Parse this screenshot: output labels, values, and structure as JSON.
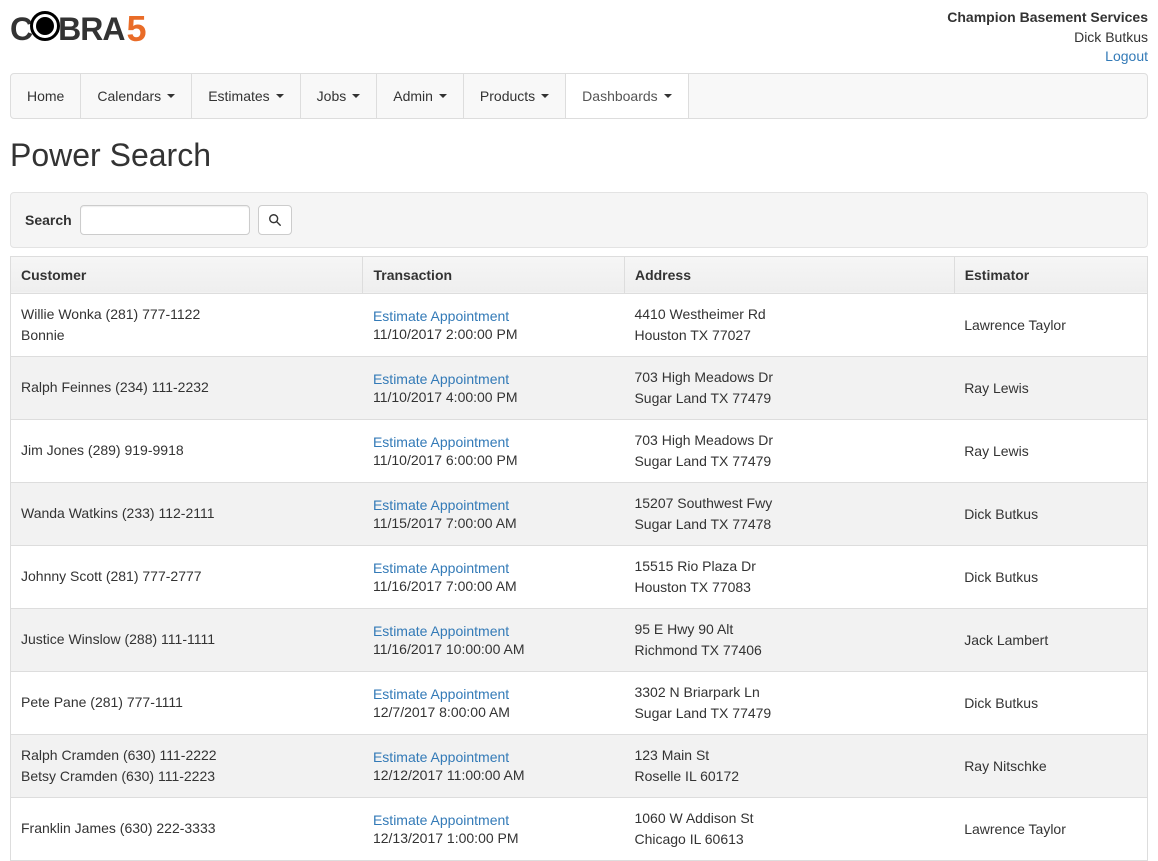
{
  "header": {
    "logo_text_1": "C",
    "logo_text_2": "BRA",
    "logo_text_3": "5",
    "company": "Champion Basement Services",
    "user": "Dick Butkus",
    "logout": "Logout"
  },
  "nav": {
    "home": "Home",
    "calendars": "Calendars",
    "estimates": "Estimates",
    "jobs": "Jobs",
    "admin": "Admin",
    "products": "Products",
    "dashboards": "Dashboards"
  },
  "page": {
    "title": "Power Search",
    "search_label": "Search",
    "search_value": ""
  },
  "table": {
    "headers": {
      "customer": "Customer",
      "transaction": "Transaction",
      "address": "Address",
      "estimator": "Estimator"
    },
    "rows": [
      {
        "cust1": "Willie Wonka (281) 777-1122",
        "cust2": "Bonnie",
        "trans_label": "Estimate Appointment",
        "trans_time": "11/10/2017 2:00:00 PM",
        "addr1": "4410 Westheimer Rd",
        "addr2": "Houston TX 77027",
        "estimator": "Lawrence Taylor"
      },
      {
        "cust1": "Ralph Feinnes (234) 111-2232",
        "cust2": "",
        "trans_label": "Estimate Appointment",
        "trans_time": "11/10/2017 4:00:00 PM",
        "addr1": "703 High Meadows Dr",
        "addr2": "Sugar Land TX 77479",
        "estimator": "Ray Lewis"
      },
      {
        "cust1": "Jim Jones (289) 919-9918",
        "cust2": "",
        "trans_label": "Estimate Appointment",
        "trans_time": "11/10/2017 6:00:00 PM",
        "addr1": "703 High Meadows Dr",
        "addr2": "Sugar Land TX 77479",
        "estimator": "Ray Lewis"
      },
      {
        "cust1": "Wanda Watkins (233) 112-2111",
        "cust2": "",
        "trans_label": "Estimate Appointment",
        "trans_time": "11/15/2017 7:00:00 AM",
        "addr1": "15207 Southwest Fwy",
        "addr2": "Sugar Land TX 77478",
        "estimator": "Dick Butkus"
      },
      {
        "cust1": "Johnny Scott (281) 777-2777",
        "cust2": "",
        "trans_label": "Estimate Appointment",
        "trans_time": "11/16/2017 7:00:00 AM",
        "addr1": "15515 Rio Plaza Dr",
        "addr2": "Houston TX 77083",
        "estimator": "Dick Butkus"
      },
      {
        "cust1": "Justice Winslow (288) 111-1111",
        "cust2": "",
        "trans_label": "Estimate Appointment",
        "trans_time": "11/16/2017 10:00:00 AM",
        "addr1": "95 E Hwy 90 Alt",
        "addr2": "Richmond TX 77406",
        "estimator": "Jack Lambert"
      },
      {
        "cust1": "Pete Pane (281) 777-1111",
        "cust2": "",
        "trans_label": "Estimate Appointment",
        "trans_time": "12/7/2017 8:00:00 AM",
        "addr1": "3302 N Briarpark Ln",
        "addr2": "Sugar Land TX 77479",
        "estimator": "Dick Butkus"
      },
      {
        "cust1": "Ralph Cramden (630) 111-2222",
        "cust2": "Betsy Cramden (630) 111-2223",
        "trans_label": "Estimate Appointment",
        "trans_time": "12/12/2017 11:00:00 AM",
        "addr1": "123 Main St",
        "addr2": "Roselle IL 60172",
        "estimator": "Ray Nitschke"
      },
      {
        "cust1": "Franklin James (630) 222-3333",
        "cust2": "",
        "trans_label": "Estimate Appointment",
        "trans_time": "12/13/2017 1:00:00 PM",
        "addr1": "1060 W Addison St",
        "addr2": "Chicago IL 60613",
        "estimator": "Lawrence Taylor"
      }
    ]
  }
}
